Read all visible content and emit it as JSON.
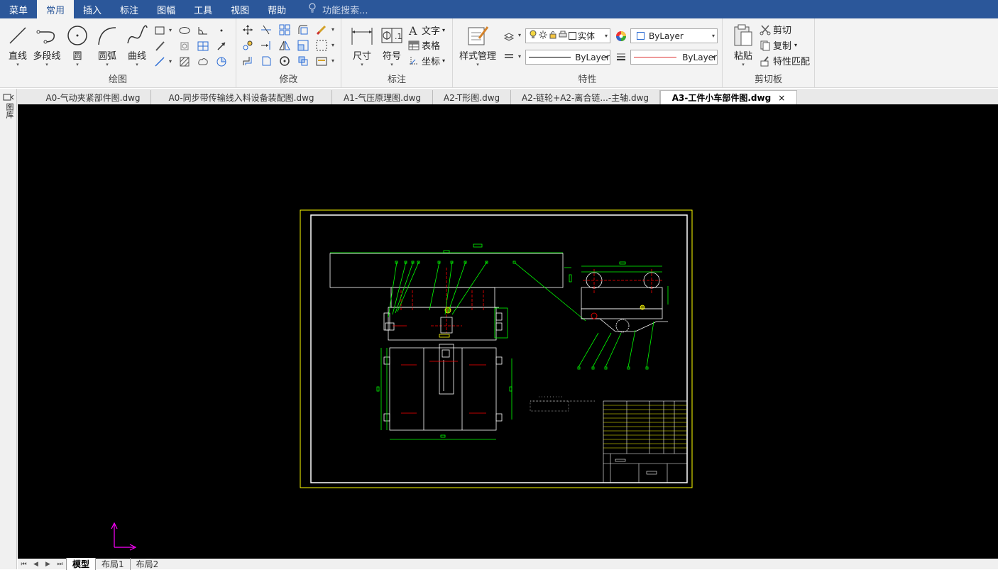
{
  "menu": {
    "items": [
      "菜单",
      "常用",
      "插入",
      "标注",
      "图幅",
      "工具",
      "视图",
      "帮助"
    ],
    "active_index": 1,
    "search_placeholder": "功能搜索..."
  },
  "ribbon": {
    "draw": {
      "title": "绘图",
      "line": "直线",
      "polyline": "多段线",
      "circle": "圆",
      "arc": "圆弧",
      "curve": "曲线"
    },
    "modify": {
      "title": "修改"
    },
    "annotate": {
      "title": "标注",
      "dimension": "尺寸",
      "symbol": "符号",
      "text": "文字",
      "table": "表格",
      "coordinate": "坐标"
    },
    "properties": {
      "title": "特性",
      "style_manager": "样式管理",
      "layer_value": "实体",
      "color_value": "ByLayer",
      "linetype_value": "ByLayer",
      "lineweight_value": "ByLayer"
    },
    "clipboard": {
      "title": "剪切板",
      "paste": "粘贴",
      "cut": "剪切",
      "copy": "复制",
      "match": "特性匹配"
    }
  },
  "sidebar": {
    "label": "图库"
  },
  "doc_tabs": [
    {
      "label": "A0-气动夹紧部件图.dwg",
      "active": false
    },
    {
      "label": "A0-同步带传输线入料设备装配图.dwg",
      "active": false
    },
    {
      "label": "A1-气压原理图.dwg",
      "active": false
    },
    {
      "label": "A2-T形图.dwg",
      "active": false
    },
    {
      "label": "A2-链轮+A2-离合链...-主轴.dwg",
      "active": false
    },
    {
      "label": "A3-工件小车部件图.dwg",
      "active": true
    }
  ],
  "layout_tabs": [
    "模型",
    "布局1",
    "布局2"
  ],
  "colors": {
    "menubar": "#2b579a",
    "canvas": "#000000",
    "drawing_green": "#00ff00",
    "drawing_white": "#ffffff",
    "drawing_yellow": "#ffff00",
    "drawing_red": "#ff0000",
    "ucs_magenta": "#ff00ff"
  }
}
